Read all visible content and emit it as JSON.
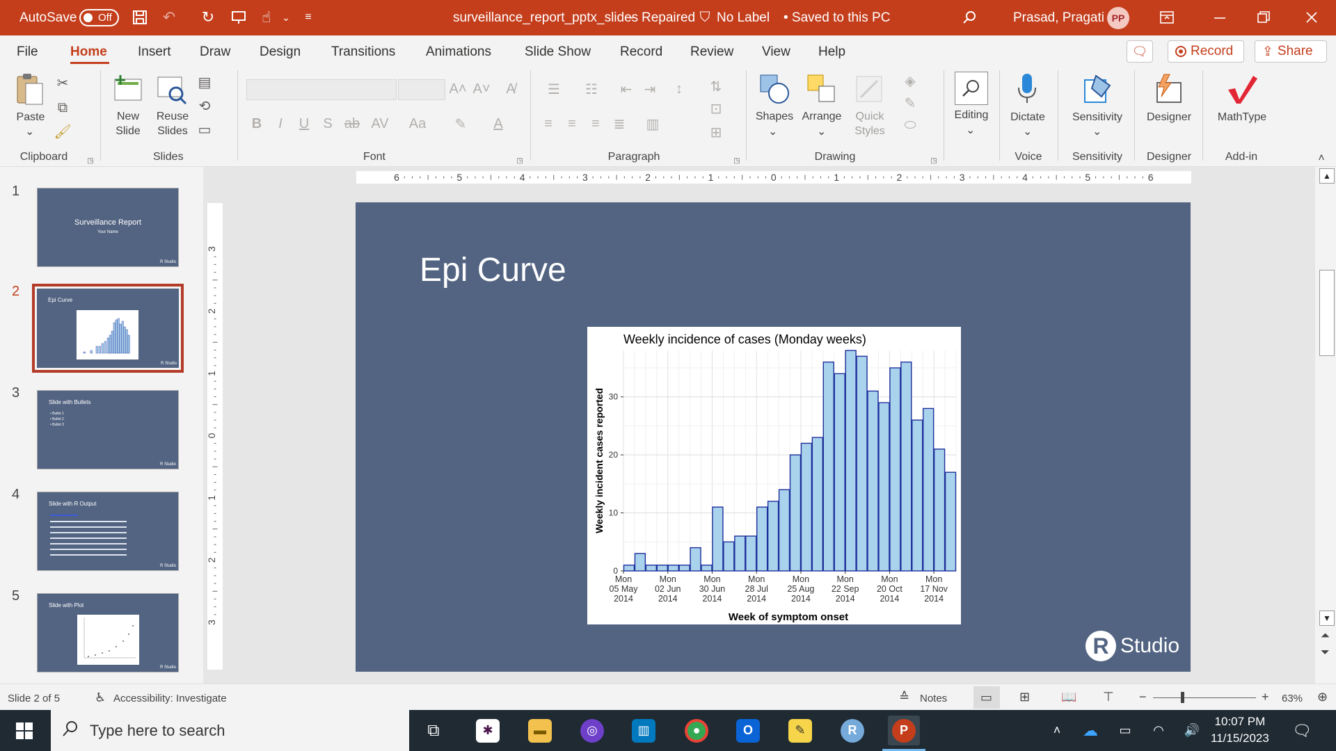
{
  "titlebar": {
    "autosave_label": "AutoSave",
    "autosave_state": "Off",
    "doc_title": "surveillance_report_pptx_slides",
    "repaired": "Repaired",
    "label_status": "No Label",
    "save_status": "• Saved to this PC",
    "user_name": "Prasad, Pragati",
    "user_initials": "PP"
  },
  "tabs": [
    "File",
    "Home",
    "Insert",
    "Draw",
    "Design",
    "Transitions",
    "Animations",
    "Slide Show",
    "Record",
    "Review",
    "View",
    "Help"
  ],
  "active_tab": "Home",
  "tab_buttons": {
    "record": "Record",
    "share": "Share"
  },
  "ribbon": {
    "paste": "Paste",
    "new_slide": "New\nSlide",
    "reuse_slides": "Reuse\nSlides",
    "shapes": "Shapes",
    "arrange": "Arrange",
    "quick_styles": "Quick\nStyles",
    "editing": "Editing",
    "dictate": "Dictate",
    "sensitivity": "Sensitivity",
    "designer": "Designer",
    "mathtype": "MathType",
    "groups": {
      "clipboard": "Clipboard",
      "slides": "Slides",
      "font": "Font",
      "paragraph": "Paragraph",
      "drawing": "Drawing",
      "voice": "Voice",
      "sensitivity": "Sensitivity",
      "designer": "Designer",
      "addin": "Add-in"
    }
  },
  "thumbnails": [
    {
      "num": "1",
      "title": "Surveillance Report",
      "sub": "Your Name"
    },
    {
      "num": "2",
      "title": "Epi Curve"
    },
    {
      "num": "3",
      "title": "Slide with Bullets",
      "bullets": [
        "• Bullet 1",
        "• Bullet 2",
        "• Bullet 3"
      ]
    },
    {
      "num": "4",
      "title": "Slide with R Output"
    },
    {
      "num": "5",
      "title": "Slide with Plot"
    }
  ],
  "thumb_brand": "R Studio",
  "hruler_ticks": [
    "6",
    "5",
    "4",
    "3",
    "2",
    "1",
    "0",
    "1",
    "2",
    "3",
    "4",
    "5",
    "6"
  ],
  "vruler_ticks": [
    "3",
    "2",
    "1",
    "0",
    "1",
    "2",
    "3"
  ],
  "slide": {
    "title": "Epi Curve",
    "brand_r": "R",
    "brand_text": "Studio"
  },
  "chart_data": {
    "type": "bar",
    "title": "Weekly incidence of cases (Monday weeks)",
    "xlabel": "Week of symptom onset",
    "ylabel": "Weekly incident cases reported",
    "ylim": [
      0,
      38
    ],
    "yticks": [
      0,
      10,
      20,
      30
    ],
    "grid": true,
    "legend": "none",
    "x_tick_labels": [
      [
        "Mon",
        "05 May",
        "2014"
      ],
      [
        "Mon",
        "02 Jun",
        "2014"
      ],
      [
        "Mon",
        "30 Jun",
        "2014"
      ],
      [
        "Mon",
        "28 Jul",
        "2014"
      ],
      [
        "Mon",
        "25 Aug",
        "2014"
      ],
      [
        "Mon",
        "22 Sep",
        "2014"
      ],
      [
        "Mon",
        "20 Oct",
        "2014"
      ],
      [
        "Mon",
        "17 Nov",
        "2014"
      ]
    ],
    "x_tick_positions": [
      0,
      4,
      8,
      12,
      16,
      20,
      24,
      28
    ],
    "weeks": [
      "2014-05-05",
      "2014-05-12",
      "2014-05-19",
      "2014-05-26",
      "2014-06-02",
      "2014-06-09",
      "2014-06-16",
      "2014-06-23",
      "2014-06-30",
      "2014-07-07",
      "2014-07-14",
      "2014-07-21",
      "2014-07-28",
      "2014-08-04",
      "2014-08-11",
      "2014-08-18",
      "2014-08-25",
      "2014-09-01",
      "2014-09-08",
      "2014-09-15",
      "2014-09-22",
      "2014-09-29",
      "2014-10-06",
      "2014-10-13",
      "2014-10-20",
      "2014-10-27",
      "2014-11-03",
      "2014-11-10",
      "2014-11-17",
      "2014-11-24"
    ],
    "values": [
      1,
      3,
      1,
      1,
      1,
      1,
      4,
      1,
      11,
      5,
      6,
      6,
      11,
      12,
      14,
      20,
      22,
      23,
      36,
      34,
      38,
      37,
      31,
      29,
      35,
      36,
      26,
      28,
      21,
      17
    ],
    "bar_color": "#a9d3ec",
    "edge_color": "#1f2f9c"
  },
  "status": {
    "slide_info": "Slide 2 of 5",
    "accessibility": "Accessibility: Investigate",
    "notes": "Notes",
    "zoom": "63%"
  },
  "taskbar": {
    "search_placeholder": "Type here to search",
    "time": "10:07 PM",
    "date": "11/15/2023"
  },
  "colors": {
    "accent": "#c43e1c",
    "slide_bg": "#536482",
    "taskbar": "#1f2a33"
  }
}
